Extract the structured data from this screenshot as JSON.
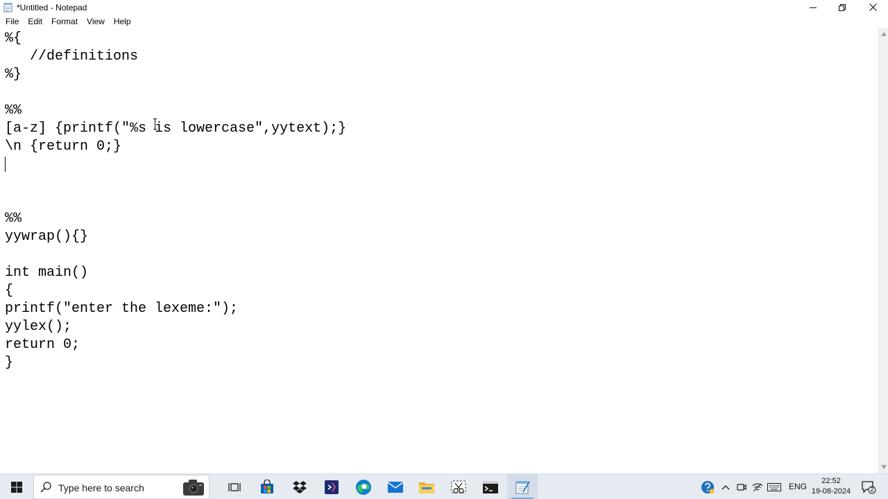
{
  "window": {
    "title": "*Untitled - Notepad"
  },
  "menu": {
    "items": [
      "File",
      "Edit",
      "Format",
      "View",
      "Help"
    ]
  },
  "editor": {
    "lines": [
      "%{",
      "   //definitions",
      "%}",
      "",
      "%%",
      "[a-z] {printf(\"%s is lowercase\",yytext);}",
      "\\n {return 0;}",
      "",
      "",
      "",
      "%%",
      "yywrap(){}",
      "",
      "int main()",
      "{",
      "printf(\"enter the lexeme:\");",
      "yylex();",
      "return 0;",
      "}"
    ]
  },
  "taskbar": {
    "search_placeholder": "Type here to search",
    "language": "ENG",
    "time": "22:52",
    "date": "19-08-2024",
    "notification_count": "2"
  },
  "icons": {
    "app": "notepad-icon",
    "start": "windows-logo-icon",
    "search": "search-icon",
    "camera": "camera-icon",
    "task_view": "task-view-icon",
    "store": "store-icon",
    "dropbox": "dropbox-icon",
    "visual_studio": "visual-studio-icon",
    "edge": "edge-icon",
    "mail": "mail-icon",
    "file_explorer": "file-explorer-icon",
    "snipping": "snipping-tool-icon",
    "terminal": "command-prompt-icon",
    "notepad_taskbar": "notepad-icon"
  },
  "colors": {
    "taskbar_bg": "#e6ebf2",
    "accent": "#0078d7"
  }
}
